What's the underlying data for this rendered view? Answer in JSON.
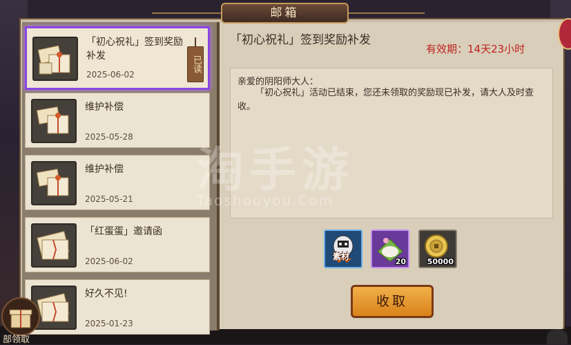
{
  "window": {
    "title": "邮箱"
  },
  "mail_list": [
    {
      "title": "「初心祝礼」签到奖励补发",
      "date": "2025-06-02",
      "read_label": "已读",
      "icon": "gift-package-icon"
    },
    {
      "title": "维护补偿",
      "date": "2025-05-28",
      "icon": "gift-package-icon"
    },
    {
      "title": "维护补偿",
      "date": "2025-05-21",
      "icon": "gift-package-icon"
    },
    {
      "title": "「红蛋蛋」邀请函",
      "date": "2025-06-02",
      "icon": "letter-bundle-icon"
    },
    {
      "title": "好久不见!",
      "date": "2025-01-23",
      "icon": "letter-bundle-icon"
    }
  ],
  "detail": {
    "title": "「初心祝礼」签到奖励补发",
    "expiry": "有效期：14天23小时",
    "greeting": "亲爱的阴阳师大人：",
    "body": "「初心祝礼」活动已结束，您还未领取的奖励现已补发，请大人及时查收。",
    "rewards": [
      {
        "icon": "daruma-icon",
        "tag": "素材",
        "qty": ""
      },
      {
        "icon": "rice-cake-icon",
        "tag": "",
        "qty": "20"
      },
      {
        "icon": "gold-coin-icon",
        "tag": "",
        "qty": "50000"
      }
    ],
    "collect_label": "收取"
  },
  "collect_all_label": "部领取",
  "watermark": {
    "main": "淘手游",
    "sub": "Taoshouyou.Com"
  },
  "colors": {
    "selected_border": "#8a46e0",
    "expiry": "#c0221e",
    "button": "#e69a30"
  }
}
